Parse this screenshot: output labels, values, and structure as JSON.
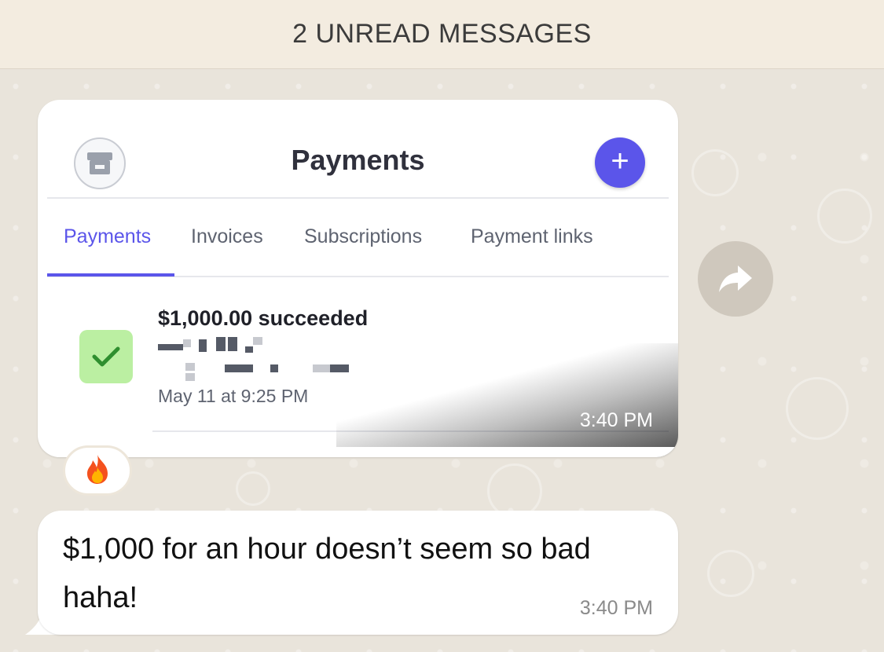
{
  "unread_banner": {
    "text": "2 UNREAD MESSAGES"
  },
  "image_message": {
    "time": "3:40 PM",
    "screenshot": {
      "header": {
        "title": "Payments",
        "add_button": "+",
        "left_icon": "store-icon"
      },
      "tabs": [
        {
          "label": "Payments",
          "active": true
        },
        {
          "label": "Invoices",
          "active": false
        },
        {
          "label": "Subscriptions",
          "active": false
        },
        {
          "label": "Payment links",
          "active": false
        }
      ],
      "payment": {
        "amount_status": "$1,000.00 succeeded",
        "status_icon": "check-icon",
        "date": "May 11 at 9:25 PM"
      }
    }
  },
  "forward_button": {
    "icon": "forward-icon"
  },
  "reaction": {
    "emoji": "🔥"
  },
  "text_message": {
    "text": "$1,000 for an hour doesn’t seem so bad haha!",
    "time": "3:40 PM"
  },
  "colors": {
    "accent": "#5b55ea",
    "success_bg": "#bbefa2",
    "success_check": "#2f8f2f",
    "banner_bg": "#f3ece0",
    "chat_bg": "#e9e4db"
  }
}
